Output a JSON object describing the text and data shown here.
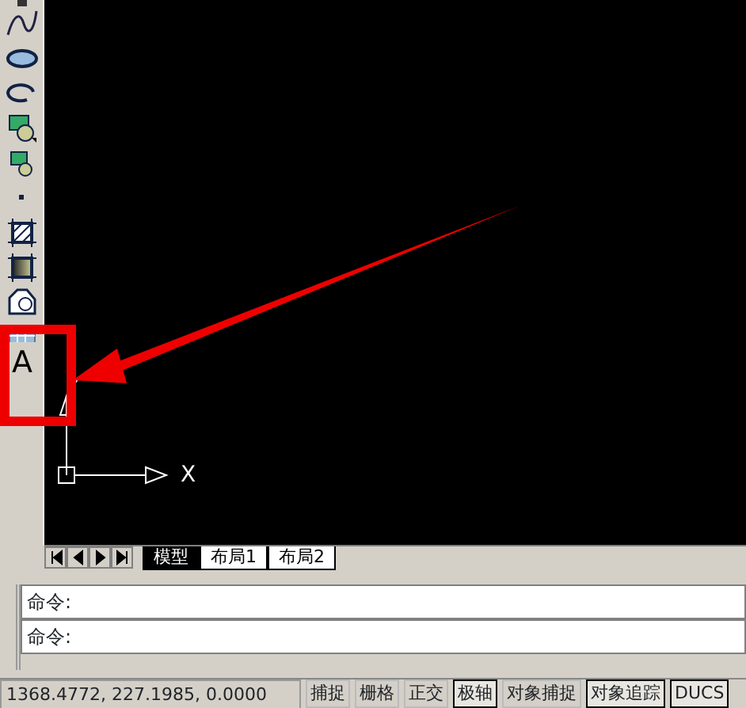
{
  "toolbar": {
    "items": [
      {
        "kind": "partial"
      },
      {
        "kind": "spline"
      },
      {
        "kind": "ellipse"
      },
      {
        "kind": "ellipse-arc"
      },
      {
        "kind": "insert-block"
      },
      {
        "kind": "make-block"
      },
      {
        "kind": "point"
      },
      {
        "kind": "hatch"
      },
      {
        "kind": "gradient"
      },
      {
        "kind": "region"
      },
      {
        "kind": "table"
      },
      {
        "kind": "text",
        "glyph": "A"
      }
    ]
  },
  "canvas": {
    "axis_label": "X"
  },
  "layout_tabs": [
    {
      "label": "模型",
      "selected": true
    },
    {
      "label": "布局1",
      "selected": false
    },
    {
      "label": "布局2",
      "selected": false
    }
  ],
  "command_lines": [
    "命令:",
    "命令:"
  ],
  "status_bar": {
    "coordinates": "1368.4772, 227.1985, 0.0000",
    "toggles": [
      {
        "label": "捕捉",
        "on": false
      },
      {
        "label": "栅格",
        "on": false
      },
      {
        "label": "正交",
        "on": false
      },
      {
        "label": "极轴",
        "on": true
      },
      {
        "label": "对象捕捉",
        "on": false
      },
      {
        "label": "对象追踪",
        "on": true
      },
      {
        "label": "DUCS",
        "on": true
      }
    ]
  }
}
